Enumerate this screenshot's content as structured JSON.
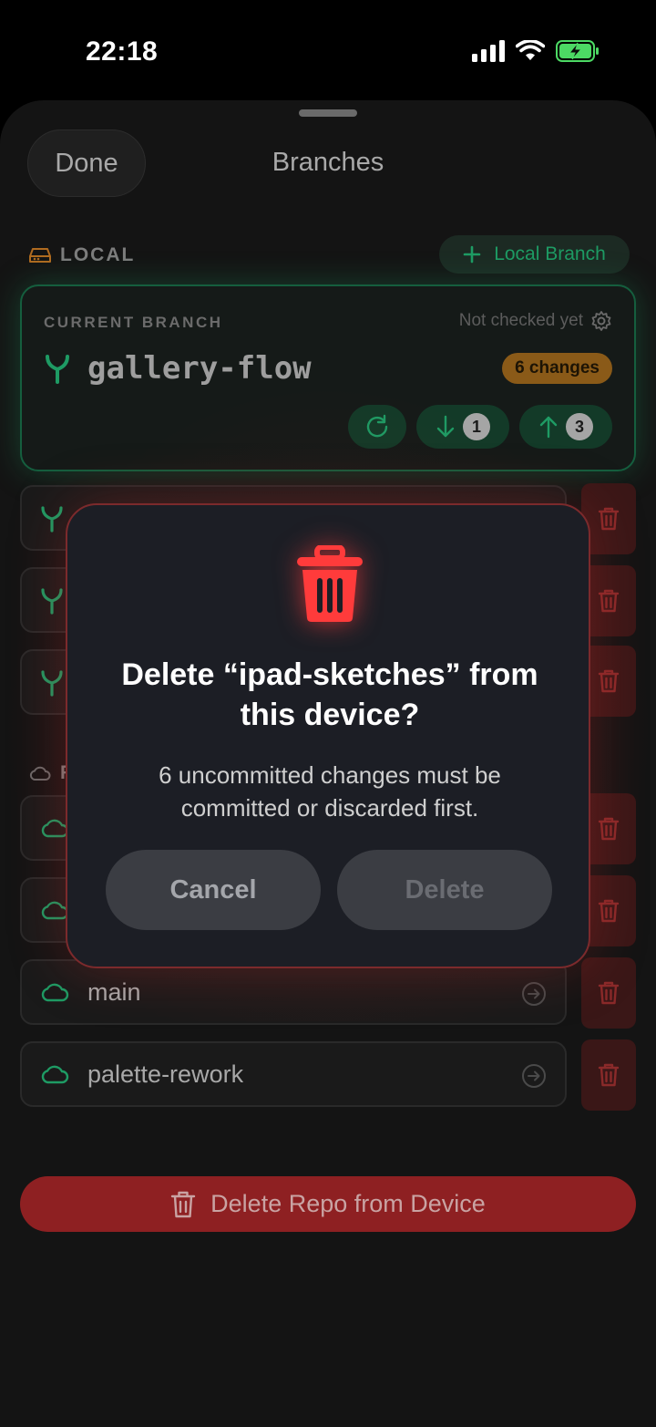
{
  "status_bar": {
    "time": "22:18"
  },
  "sheet": {
    "done_label": "Done",
    "title": "Branches"
  },
  "local_section": {
    "heading": "LOCAL",
    "add_button_label": "Local Branch"
  },
  "current_branch": {
    "label": "CURRENT BRANCH",
    "status": "Not checked yet",
    "name": "gallery-flow",
    "changes_badge": "6 changes",
    "incoming_count": "1",
    "outgoing_count": "3"
  },
  "remote_section": {
    "heading_visible_initial": "R"
  },
  "remote_rows": [
    {
      "label": "main"
    },
    {
      "label": "palette-rework"
    }
  ],
  "delete_repo_label": "Delete Repo from Device",
  "dialog": {
    "title_line1": "Delete “ipad-sketches” from",
    "title_line2": "this device?",
    "message_line1": "6 uncommitted changes must be",
    "message_line2": "committed or discarded first.",
    "cancel_label": "Cancel",
    "delete_label": "Delete"
  },
  "colors": {
    "accent_green": "#1e9b64",
    "danger_red": "#ff3b3b",
    "badge_orange": "#8a5a18"
  }
}
